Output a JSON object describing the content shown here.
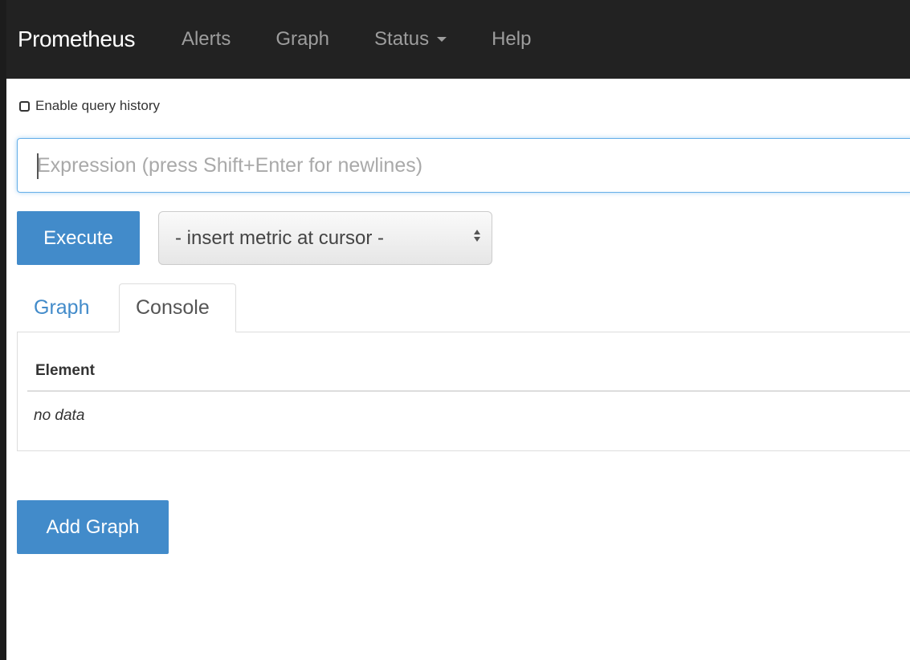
{
  "navbar": {
    "brand": "Prometheus",
    "items": [
      "Alerts",
      "Graph",
      "Status",
      "Help"
    ]
  },
  "history": {
    "label": "Enable query history",
    "checked": false
  },
  "expression": {
    "placeholder": "Expression (press Shift+Enter for newlines)",
    "value": ""
  },
  "execute_label": "Execute",
  "metric_select": {
    "selected": "- insert metric at cursor -"
  },
  "tabs": [
    {
      "label": "Graph",
      "active": false
    },
    {
      "label": "Console",
      "active": true
    }
  ],
  "console_table": {
    "header": "Element",
    "empty_text": "no data"
  },
  "add_graph_label": "Add Graph",
  "colors": {
    "navbar_bg": "#222222",
    "primary": "#428bca",
    "focus_border": "#66afe9"
  }
}
